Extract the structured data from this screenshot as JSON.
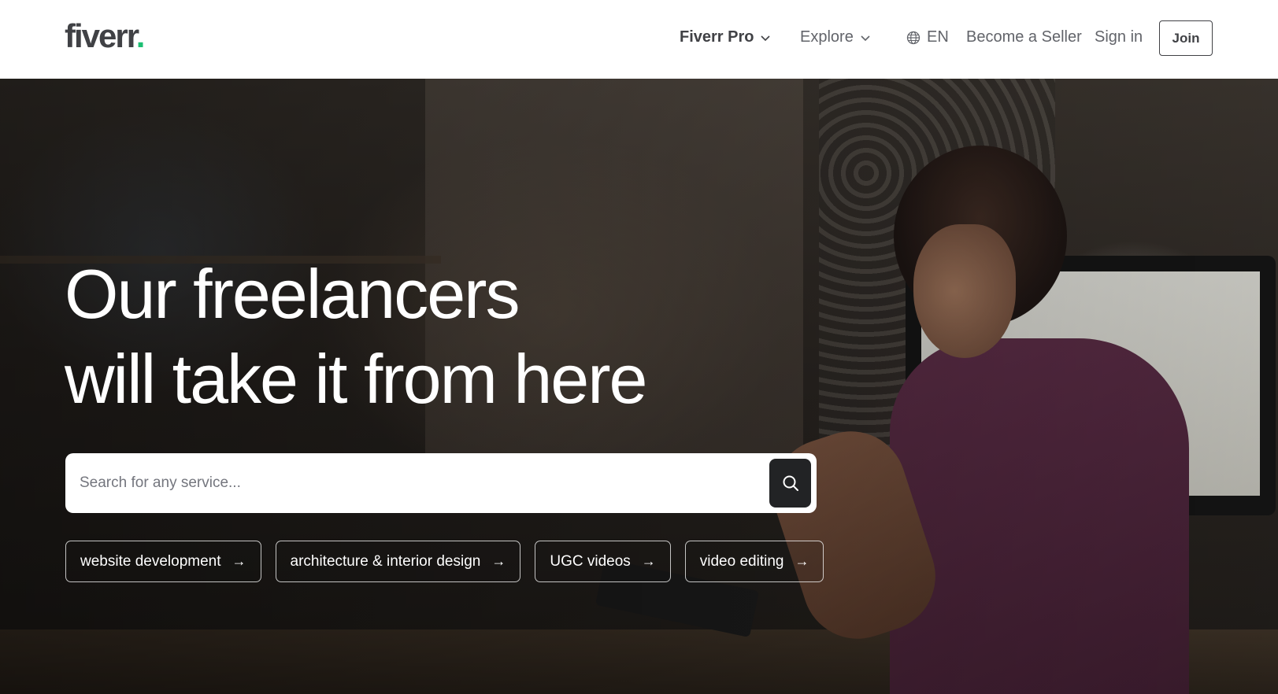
{
  "header": {
    "logo_text": "fiverr",
    "logo_dot": ".",
    "nav": {
      "fiverr_pro": "Fiverr Pro",
      "explore": "Explore",
      "language": "EN",
      "become_seller": "Become a Seller",
      "sign_in": "Sign in",
      "join": "Join"
    }
  },
  "hero": {
    "headline_line1": "Our freelancers",
    "headline_line2": "will take it from here",
    "search": {
      "placeholder": "Search for any service..."
    },
    "chips": [
      {
        "label": "website development",
        "arrow": "→"
      },
      {
        "label": "architecture & interior design",
        "arrow": "→"
      },
      {
        "label": "UGC videos",
        "arrow": "→"
      },
      {
        "label": "video editing",
        "arrow": "→"
      }
    ]
  },
  "colors": {
    "brand_green": "#1dbf73",
    "text_dark": "#404145",
    "search_button": "#222325"
  },
  "icons": [
    "chevron-down-icon",
    "globe-icon",
    "search-icon",
    "arrow-right-icon"
  ]
}
